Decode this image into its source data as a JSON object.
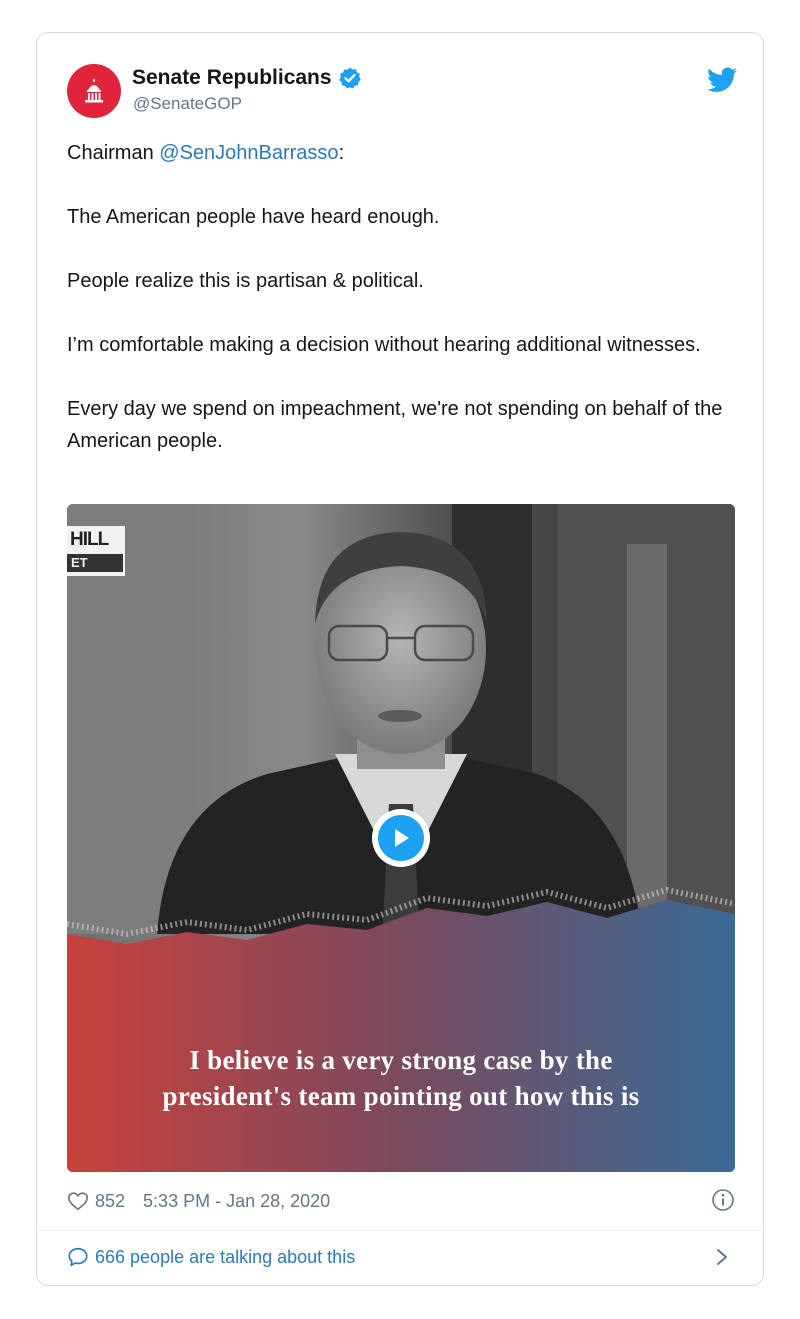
{
  "author": {
    "name": "Senate Republicans",
    "handle": "@SenateGOP",
    "verified": true,
    "avatar_color": "#e0243c"
  },
  "tweet": {
    "prefix": "Chairman ",
    "mention": "@SenJohnBarrasso",
    "suffix": ":",
    "paragraphs": [
      "The American people have heard enough.",
      "People realize this is partisan & political.",
      "I’m comfortable making a decision without hearing additional witnesses.",
      "Every day we spend on impeachment, we're not spending on behalf of the American people."
    ]
  },
  "media": {
    "badge_top": "HILL",
    "badge_bottom": "ET",
    "caption_line1": "I believe is a very strong case by the",
    "caption_line2": "president's team pointing out how this is",
    "gradient_left": "#c8413c",
    "gradient_right": "#3a6a96",
    "play_color": "#1da1f2"
  },
  "footer": {
    "likes": "852",
    "timestamp": "5:33 PM - Jan 28, 2020",
    "talking": "666 people are talking about this"
  },
  "icons": {
    "brand": "twitter-bird-icon",
    "like": "heart-icon",
    "info": "info-icon",
    "reply": "speech-bubble-icon",
    "next": "chevron-right-icon"
  },
  "colors": {
    "link": "#2b7bb9",
    "muted": "#657786",
    "text": "#14171a"
  }
}
